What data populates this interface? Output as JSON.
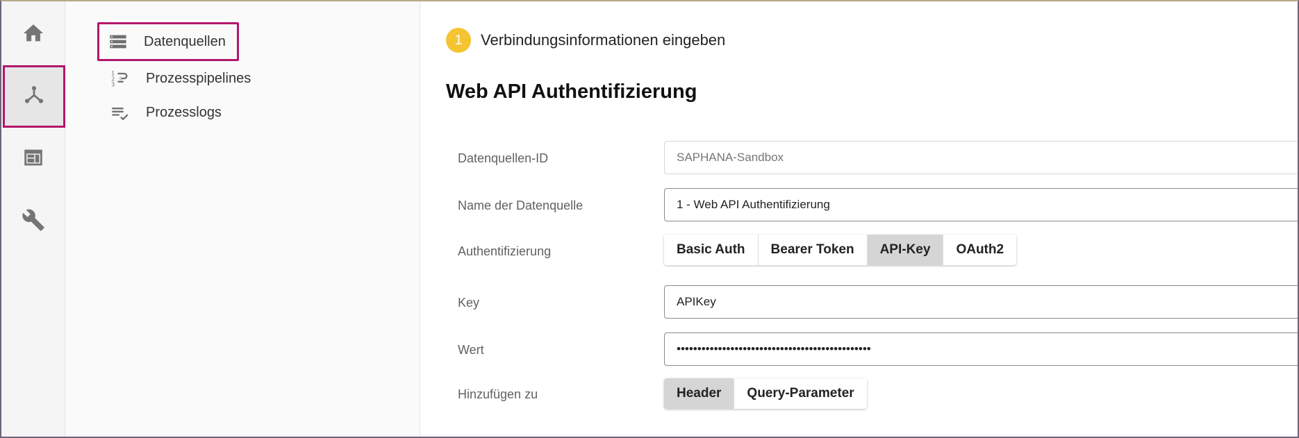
{
  "rail": {
    "items": [
      {
        "icon": "home-icon"
      },
      {
        "icon": "data-hub-icon",
        "active": true
      },
      {
        "icon": "dashboard-icon"
      },
      {
        "icon": "wrench-icon"
      }
    ]
  },
  "subnav": {
    "items": [
      {
        "label": "Datenquellen",
        "icon": "datasources-icon",
        "selected": true
      },
      {
        "label": "Prozesspipelines",
        "icon": "pipelines-icon"
      },
      {
        "label": "Prozesslogs",
        "icon": "process-logs-icon"
      }
    ]
  },
  "step": {
    "number": "1",
    "text": "Verbindungsinformationen eingeben"
  },
  "title": "Web API Authentifizierung",
  "form": {
    "datasource_id": {
      "label": "Datenquellen-ID",
      "placeholder": "SAPHANA-Sandbox"
    },
    "name": {
      "label": "Name der Datenquelle",
      "value": "1 - Web API Authentifizierung"
    },
    "auth": {
      "label": "Authentifizierung",
      "options": [
        "Basic Auth",
        "Bearer Token",
        "API-Key",
        "OAuth2"
      ],
      "selected": "API-Key"
    },
    "key": {
      "label": "Key",
      "value": "APIKey"
    },
    "value": {
      "label": "Wert",
      "value": "•••••••••••••••••••••••••••••••••••••••••••••••"
    },
    "add_to": {
      "label": "Hinzufügen zu",
      "options": [
        "Header",
        "Query-Parameter"
      ],
      "selected": "Header"
    }
  },
  "colors": {
    "accent_highlight": "#b3166b",
    "step_badge": "#f5c431",
    "segment_selected": "#d5d5d5"
  }
}
